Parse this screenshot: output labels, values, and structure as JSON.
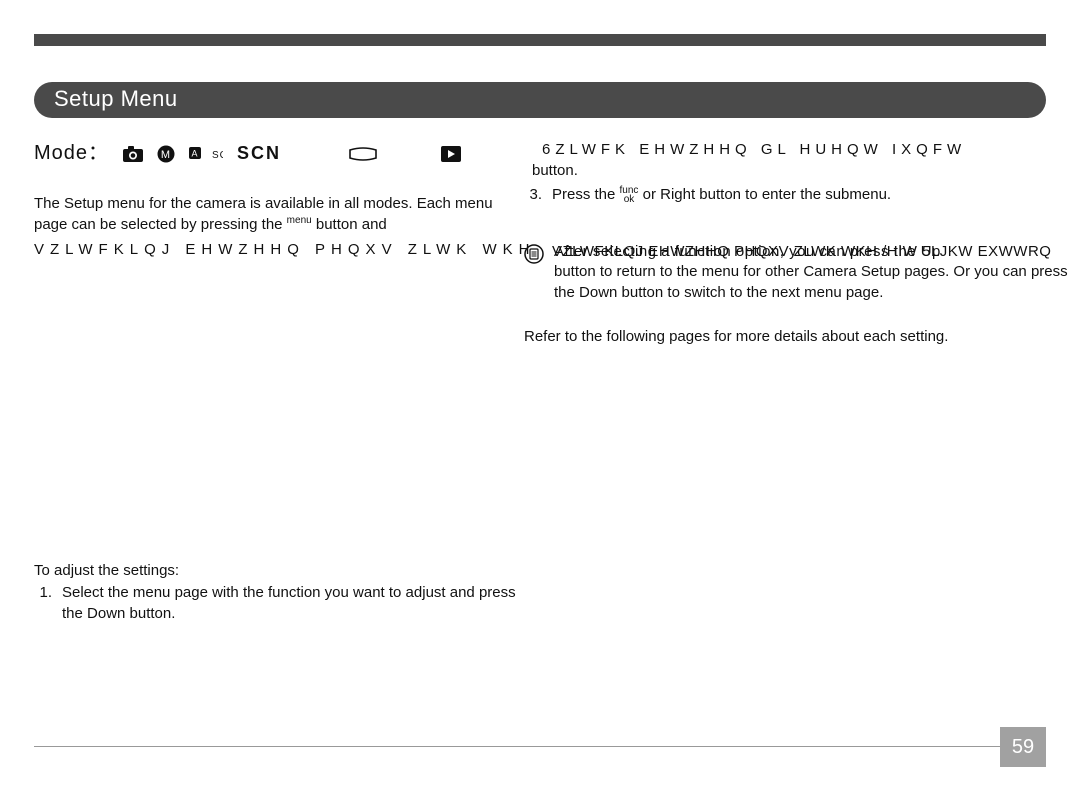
{
  "header": {
    "title": "Setup Menu"
  },
  "mode_label": "Mode：",
  "scn_text": "SCN",
  "left": {
    "intro1": "The Setup menu for the camera is available in all modes. Each menu page can be selected by pressing the ",
    "intro_menu_sup": "menu",
    "intro2": " button and ",
    "glitch_line": "VZLWFKLQJ EHWZHHQ PHQXV ZLWK WKH /HIW   5LJKW EXWWRQ",
    "steps_title": "To adjust the settings:",
    "step1": "Select the menu page with the function you want to adjust and press the Down button."
  },
  "right": {
    "glitch_top": "6ZLWFK EHWZHHQ GL HUHQW IXQFW",
    "button_word": "button.",
    "step3a": "Press the ",
    "func": "func",
    "ok": "ok",
    "step3b": " or Right button to enter the submenu.",
    "note_overlay": "After selecting a function option, you can press the Up",
    "note_rest": "button to return to the menu for other Camera Setup pages. Or you can press the Down button to switch to the next menu page.",
    "refer": "Refer to the following pages for more details about each setting."
  },
  "page_number": "59"
}
